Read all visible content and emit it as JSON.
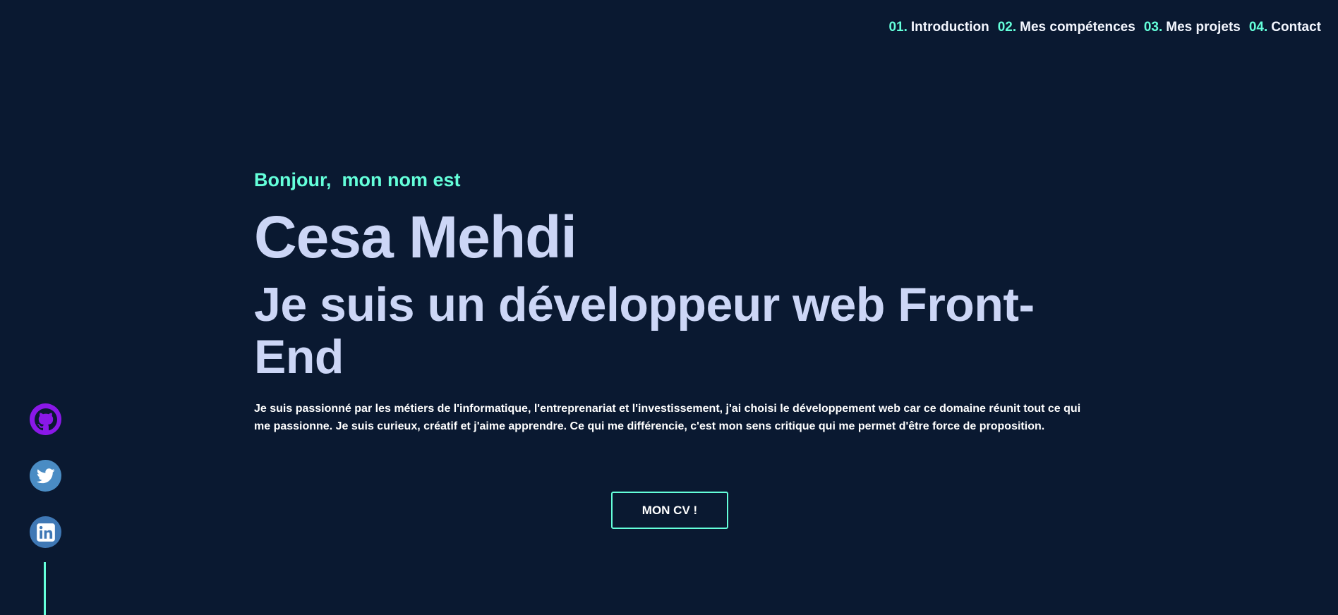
{
  "nav": {
    "items": [
      {
        "num": "01.",
        "label": "Introduction"
      },
      {
        "num": "02.",
        "label": "Mes compétences"
      },
      {
        "num": "03.",
        "label": "Mes projets"
      },
      {
        "num": "04.",
        "label": "Contact"
      }
    ]
  },
  "hero": {
    "greeting": "Bonjour,  mon nom est",
    "name": "Cesa Mehdi",
    "role": "Je suis un développeur web Front-End",
    "description": "Je suis passionné par les métiers de l'informatique, l'entreprenariat et l'investissement, j'ai choisi le développement web car ce domaine réunit tout ce qui me passionne. Je suis curieux, créatif et j'aime apprendre. Ce qui me différencie, c'est mon sens critique qui me permet d'être force de proposition.",
    "cv_button": "MON CV !"
  },
  "social": {
    "icons": [
      "github-icon",
      "twitter-icon",
      "linkedin-icon"
    ]
  },
  "colors": {
    "background": "#0a1931",
    "accent": "#64ffda",
    "heading": "#ccd6f6",
    "github": "#8a18e8",
    "twitter": "#4a8cc4",
    "linkedin": "#3f78b5"
  }
}
